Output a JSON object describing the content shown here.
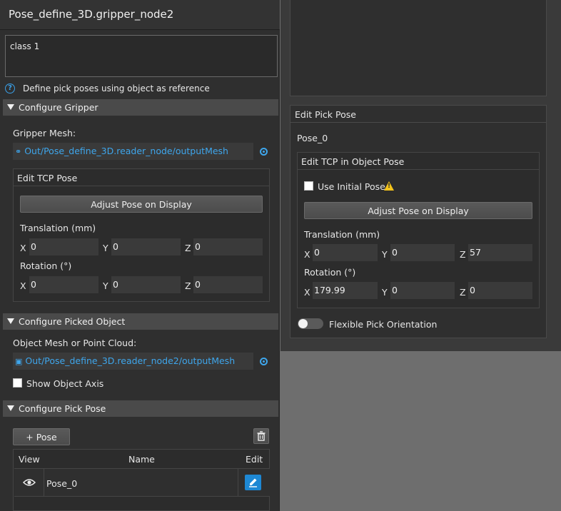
{
  "left": {
    "title": "Pose_define_3D.gripper_node2",
    "class_text": "class 1",
    "help_text": "Define pick poses using object as reference",
    "configure_gripper": {
      "header": "Configure Gripper",
      "gripper_mesh_label": "Gripper Mesh:",
      "gripper_mesh_path": "Out/Pose_define_3D.reader_node/outputMesh",
      "edit_tcp_title": "Edit TCP Pose",
      "adjust_button": "Adjust Pose on Display",
      "translation_label": "Translation (mm)",
      "translation": {
        "x": "0",
        "y": "0",
        "z": "0"
      },
      "rotation_label": "Rotation (°)",
      "rotation": {
        "x": "0",
        "y": "0",
        "z": "0"
      }
    },
    "configure_picked_object": {
      "header": "Configure Picked Object",
      "object_mesh_label": "Object Mesh or Point Cloud:",
      "object_mesh_path": "Out/Pose_define_3D.reader_node2/outputMesh",
      "show_axis_label": "Show Object Axis"
    },
    "configure_pick_pose": {
      "header": "Configure Pick Pose",
      "add_pose_button": "+ Pose",
      "table": {
        "columns": [
          "View",
          "Name",
          "Edit"
        ],
        "rows": [
          {
            "name": "Pose_0"
          }
        ]
      }
    }
  },
  "right": {
    "edit_pick_pose_title": "Edit Pick Pose",
    "pose_name": "Pose_0",
    "edit_tcp_object_title": "Edit TCP in Object Pose",
    "use_initial_pose_label": "Use Initial Pose",
    "adjust_button": "Adjust Pose on Display",
    "translation_label": "Translation (mm)",
    "translation": {
      "x": "0",
      "y": "0",
      "z": "57"
    },
    "rotation_label": "Rotation (°)",
    "rotation": {
      "x": "179.99",
      "y": "0",
      "z": "0"
    },
    "flexible_label": "Flexible Pick Orientation"
  },
  "axis_letters": {
    "x": "X",
    "y": "Y",
    "z": "Z"
  },
  "icons": {
    "help": "?",
    "link": "link-icon",
    "camera": "camera-icon",
    "eye": "eye-icon",
    "trash": "trash-icon",
    "edit": "pencil-icon",
    "warning": "!"
  },
  "colors": {
    "accent": "#3ea6ec",
    "edit_button": "#1e88d4",
    "warning": "#f2c21b"
  }
}
